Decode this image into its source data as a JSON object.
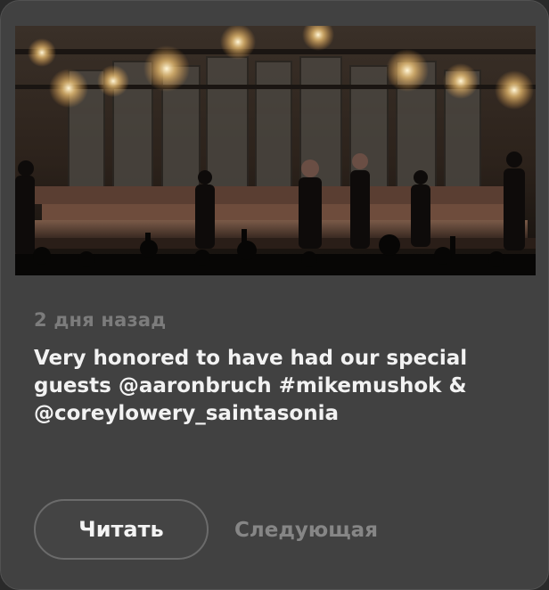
{
  "post": {
    "timestamp": "2 дня назад",
    "text": "Very honored to have had our special guests @aaronbruch #mikemushok & @coreylowery_saintasonia"
  },
  "actions": {
    "read_label": "Читать",
    "next_label": "Следующая"
  },
  "colors": {
    "card_background": "#414141",
    "text_primary": "#f2f2f2",
    "text_muted": "#7c7c7c"
  }
}
